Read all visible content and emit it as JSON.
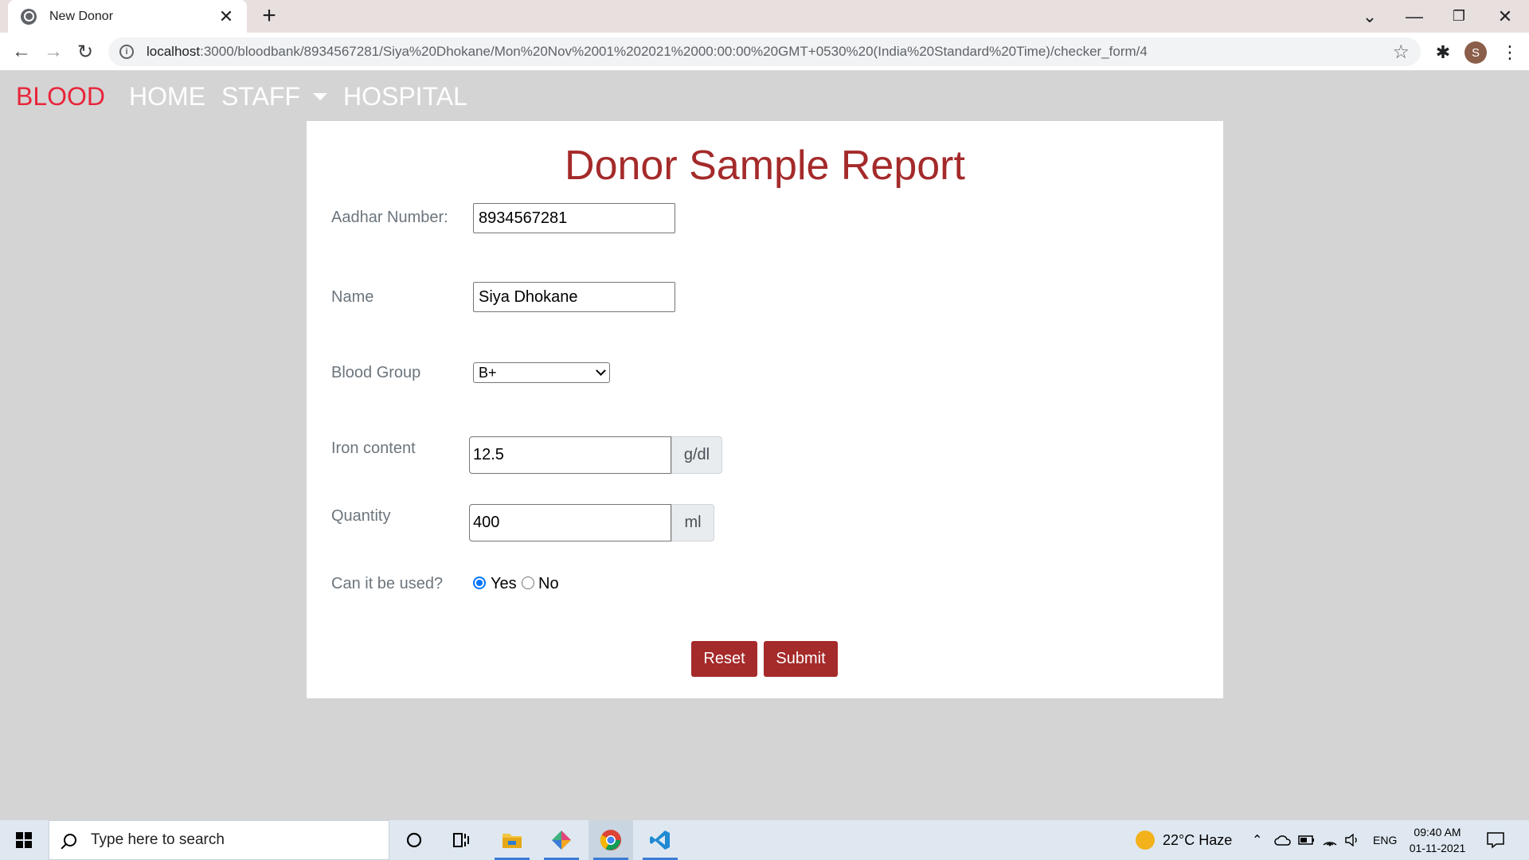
{
  "browser": {
    "tab_title": "New Donor",
    "tab_close": "✕",
    "new_tab": "+",
    "url_host": "localhost",
    "url_rest": ":3000/bloodbank/8934567281/Siya%20Dhokane/Mon%20Nov%2001%202021%2000:00:00%20GMT+0530%20(India%20Standard%20Time)/checker_form/4",
    "profile_initial": "S",
    "window_controls": {
      "tablist": "⌄",
      "minimize": "—",
      "restore": "❐",
      "close": "✕"
    },
    "nav": {
      "back": "←",
      "forward": "→",
      "reload": "↻"
    },
    "star": "☆",
    "extensions": "✱",
    "menu": "⋮"
  },
  "app_nav": {
    "brand": "BLOOD",
    "links": [
      "HOME",
      "STAFF",
      "HOSPITAL"
    ]
  },
  "form": {
    "title": "Donor Sample Report",
    "aadhar": {
      "label": "Aadhar Number:",
      "value": "8934567281"
    },
    "name": {
      "label": "Name",
      "value": "Siya Dhokane"
    },
    "blood_group": {
      "label": "Blood Group",
      "value": "B+"
    },
    "iron": {
      "label": "Iron content",
      "value": "12.5",
      "unit": "g/dl"
    },
    "quantity": {
      "label": "Quantity",
      "value": "400",
      "unit": "ml"
    },
    "usable": {
      "label": "Can it be used?",
      "yes": "Yes",
      "no": "No",
      "selected": "Yes"
    },
    "buttons": {
      "reset": "Reset",
      "submit": "Submit"
    }
  },
  "colors": {
    "brand": "#e8253a",
    "title": "#a52a2a",
    "button": "#a52a2a",
    "radio": "#0075ff"
  },
  "taskbar": {
    "search_placeholder": "Type here to search",
    "weather": "22°C  Haze",
    "lang": "ENG",
    "time": "09:40 AM",
    "date": "01-11-2021",
    "apps": [
      "cortana-icon",
      "task-view-icon",
      "file-explorer-icon",
      "gitkraken-icon",
      "chrome-icon",
      "vscode-icon"
    ]
  }
}
